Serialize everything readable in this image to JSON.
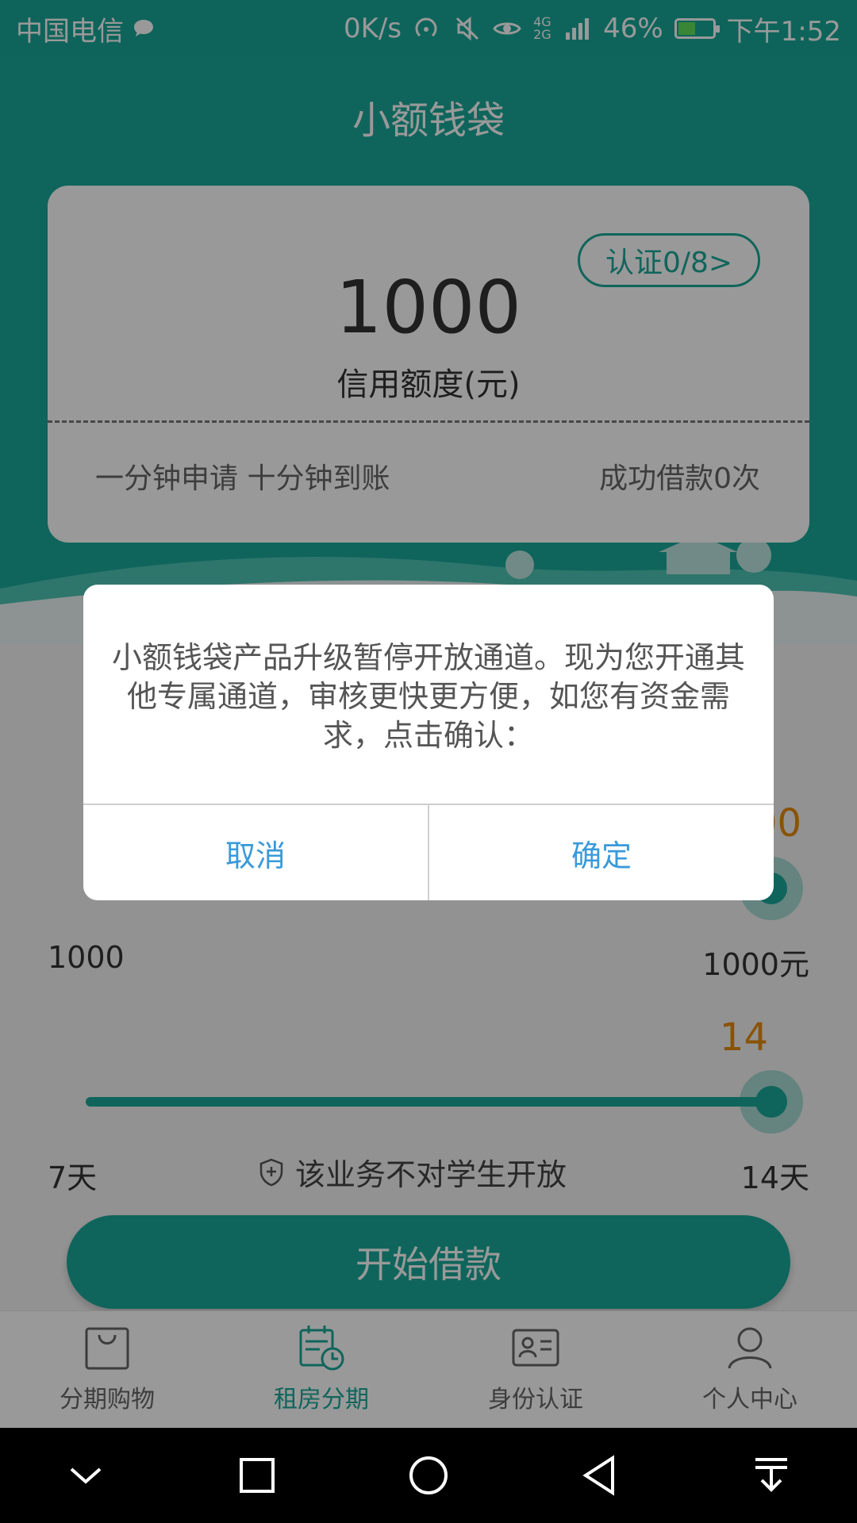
{
  "status_bar": {
    "carrier": "中国电信",
    "speed": "0K/s",
    "network": "4G 2G",
    "battery": "46%",
    "battery_level": 0.46,
    "time": "下午1:52"
  },
  "header": {
    "title": "小额钱袋"
  },
  "credit_card": {
    "auth_badge": "认证0/8>",
    "amount": "1000",
    "label": "信用额度(元)",
    "note_left": "一分钟申请 十分钟到账",
    "note_right": "成功借款0次"
  },
  "loan_amount": {
    "current": "1000",
    "min": "1000",
    "max": "1000元"
  },
  "loan_days": {
    "current": "14",
    "min": "7天",
    "max": "14天"
  },
  "notice": "该业务不对学生开放",
  "start_button": "开始借款",
  "tabs": [
    {
      "label": "分期购物",
      "icon": "shopping-bag-icon"
    },
    {
      "label": "租房分期",
      "icon": "calendar-clock-icon",
      "active": true
    },
    {
      "label": "身份认证",
      "icon": "id-card-icon"
    },
    {
      "label": "个人中心",
      "icon": "person-icon"
    }
  ],
  "dialog": {
    "message": "小额钱袋产品升级暂停开放通道。现为您开通其他专属通道，审核更快更方便，如您有资金需求，点击确认：",
    "cancel": "取消",
    "confirm": "确定"
  },
  "colors": {
    "accent": "#1aa898",
    "highlight": "#e58a0a",
    "dialog_button": "#3a9ad9"
  }
}
